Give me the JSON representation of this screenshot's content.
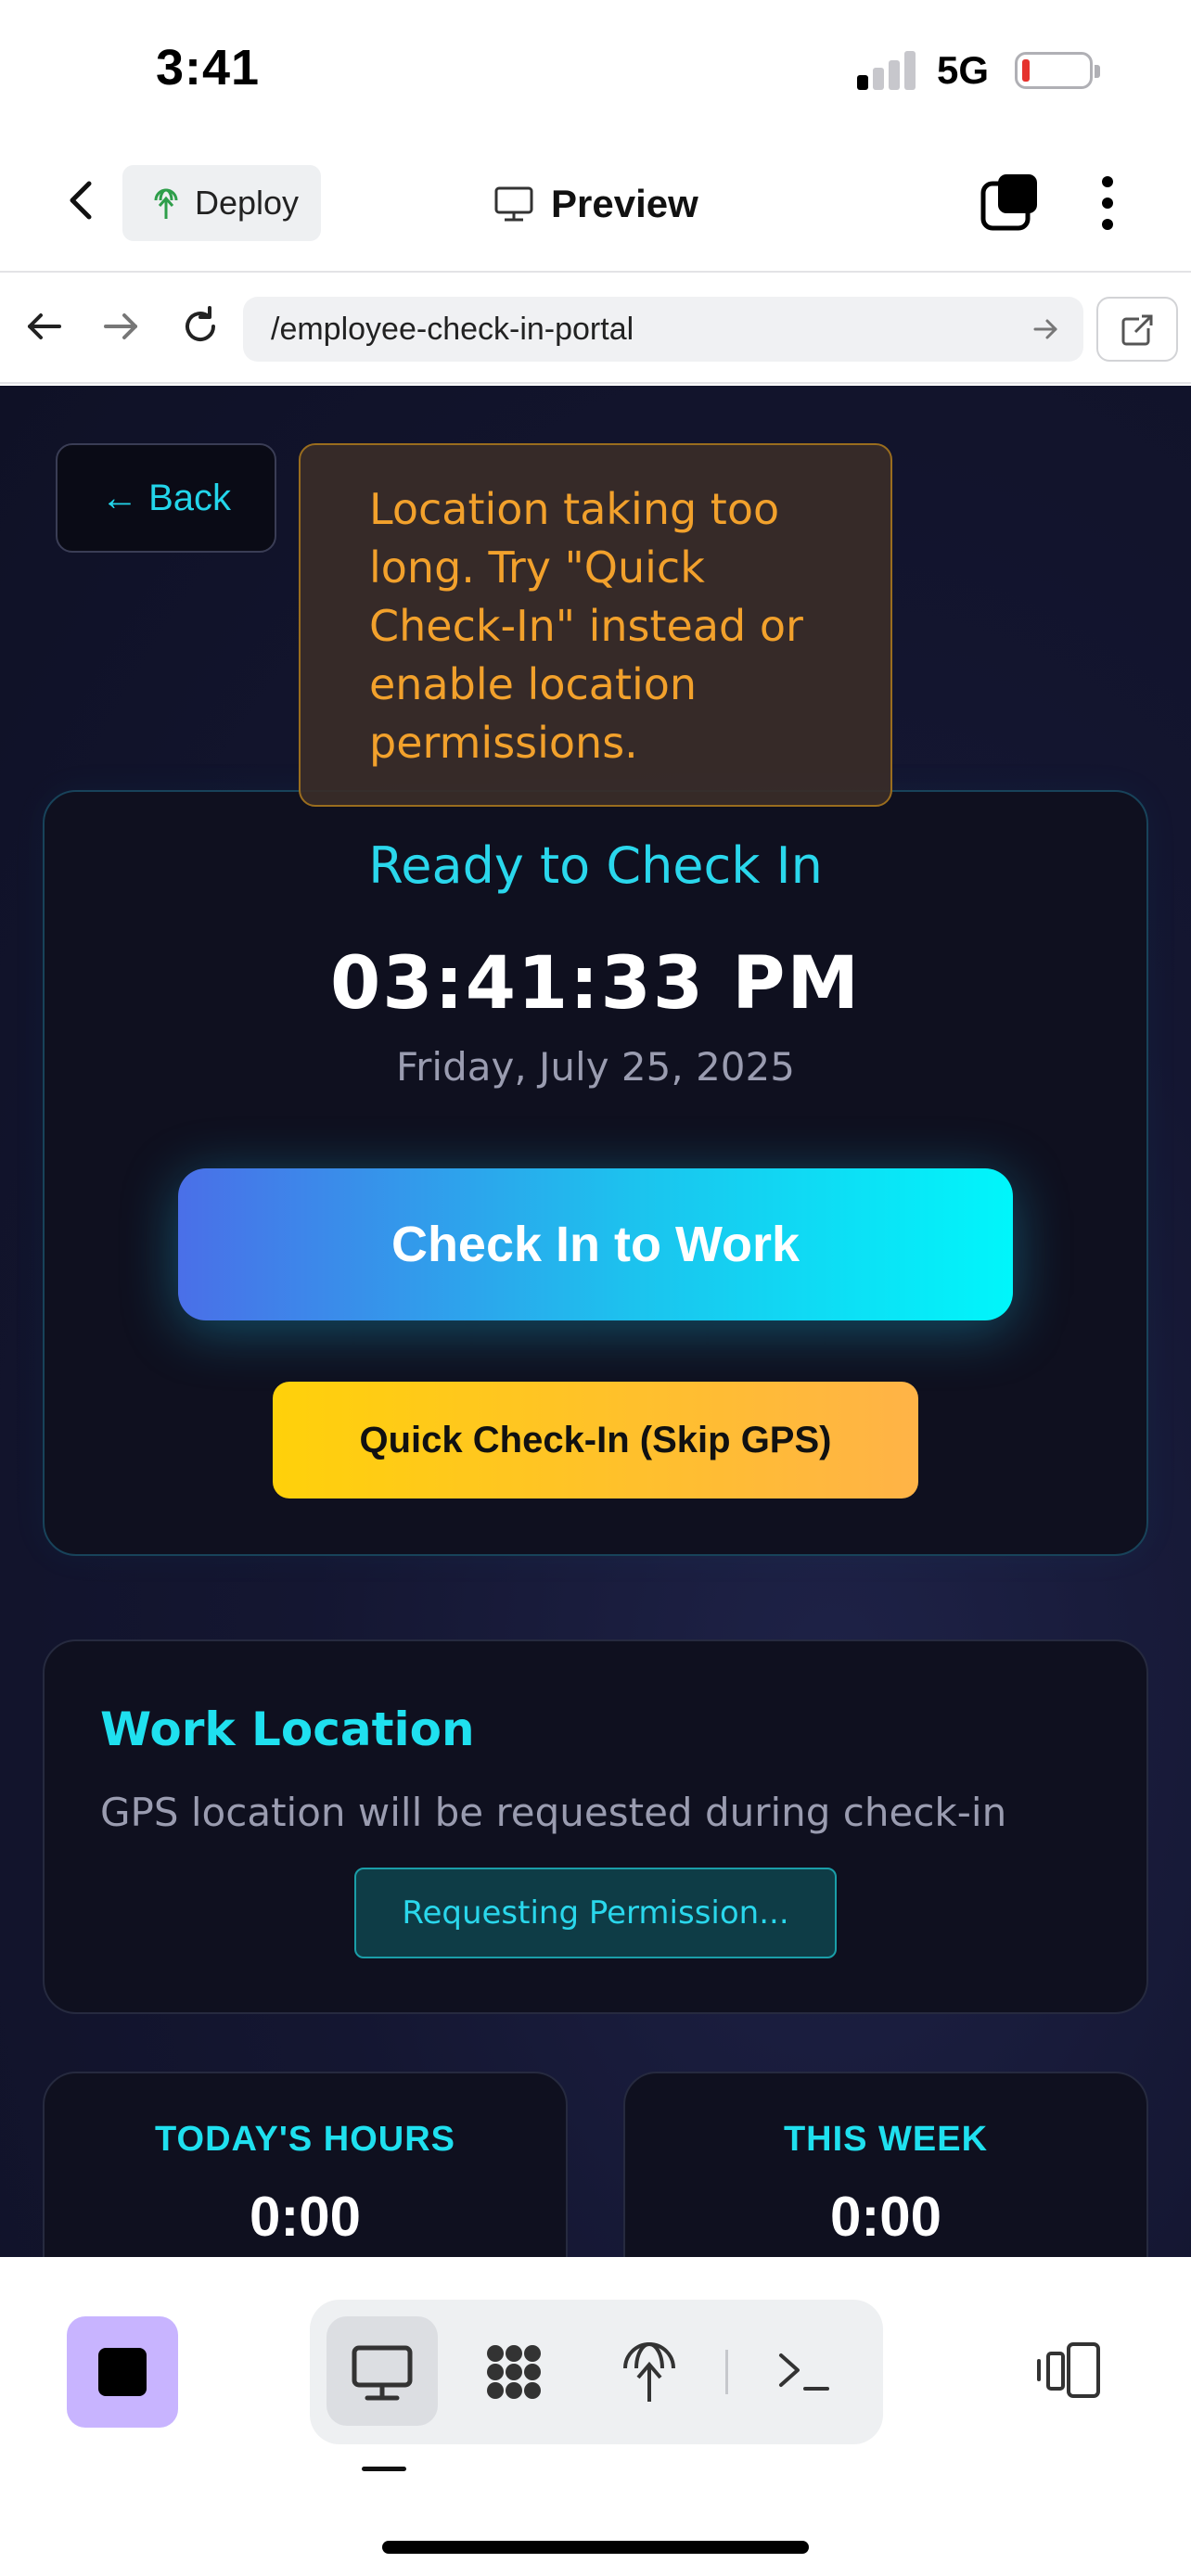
{
  "status_bar": {
    "time": "3:41",
    "network": "5G",
    "signal_bars_active": 1,
    "battery_level": 0.08
  },
  "app_toolbar": {
    "deploy_label": "Deploy",
    "preview_label": "Preview"
  },
  "browser": {
    "url": "/employee-check-in-portal"
  },
  "page": {
    "back_label": "← Back",
    "toast": "Location taking too long. Try \"Quick Check-In\" instead or enable location permissions.",
    "status_title": "Ready to Check In",
    "clock": "03:41:33 PM",
    "date": "Friday, July 25, 2025",
    "check_in_label": "Check In to Work",
    "quick_check_in_label": "Quick Check-In (Skip GPS)",
    "work_location": {
      "title": "Work Location",
      "text": "GPS location will be requested during check-in",
      "permission_label": "Requesting Permission..."
    },
    "stats": [
      {
        "label": "TODAY'S HOURS",
        "value": "0:00"
      },
      {
        "label": "THIS WEEK",
        "value": "0:00"
      }
    ]
  },
  "colors": {
    "accent": "#2ad7ec",
    "warning": "#f2a12c",
    "stop_button": "#c8b4ff",
    "background": "#141631"
  },
  "dock": {
    "icons": [
      "stop-icon",
      "desktop-icon",
      "grid-icon",
      "deploy-icon",
      "terminal-icon",
      "devices-icon"
    ]
  }
}
